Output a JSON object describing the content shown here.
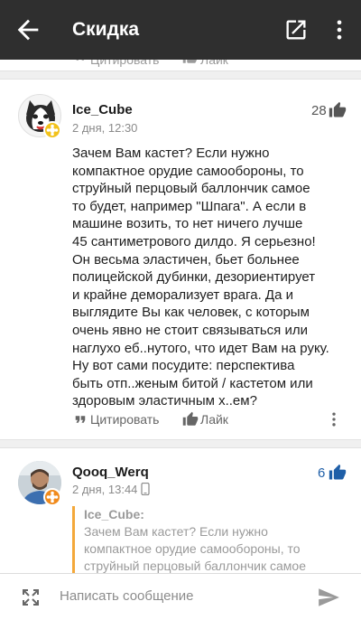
{
  "appbar": {
    "title": "Скидка",
    "back_icon": "arrow-back-icon",
    "open_icon": "open-external-icon",
    "more_icon": "more-vertical-icon"
  },
  "stub": {
    "quote_label": "Цитировать",
    "like_label": "Лайк"
  },
  "comment1": {
    "author": "Ice_Cube",
    "date": "2 дня, 12:30",
    "votes": "28",
    "text_lines": [
      "Зачем Вам кастет? Если нужно",
      "компактное орудие самообороны, то",
      "струйный перцовый баллончик самое",
      "то будет, например \"Шпага\". А если в",
      "машине возить, то нет ничего лучше",
      "45 сантиметрового дилдо. Я серьезно!",
      "Он весьма эластичен, бьет больнее",
      "полицейской дубинки, дезориентирует",
      "и крайне деморализует врага. Да и",
      "выглядите Вы как человек, с которым",
      "очень явно не стоит связываться или",
      "наглухо еб..нутого, что идет Вам на руку.",
      "Ну вот сами посудите:  перспектива",
      "быть отп..женым битой / кастетом или",
      "здоровым эластичным х..ем?"
    ],
    "quote_label": "Цитировать",
    "like_label": "Лайк"
  },
  "comment2": {
    "author": "Qooq_Werq",
    "date": "2 дня, 13:44",
    "votes": "6",
    "quote_author": "Ice_Cube:",
    "quote_lines": [
      "Зачем Вам кастет? Если нужно",
      "компактное орудие самообороны, то",
      "струйный перцовый баллончик самое"
    ]
  },
  "composer": {
    "placeholder": "Написать сообщение"
  },
  "colors": {
    "appbar": "#2f2f2f",
    "accent_blue": "#1f5fa8",
    "quote_border": "#f4a83a",
    "badge_yellow": "#f2c21b",
    "badge_orange": "#f08a1c"
  }
}
